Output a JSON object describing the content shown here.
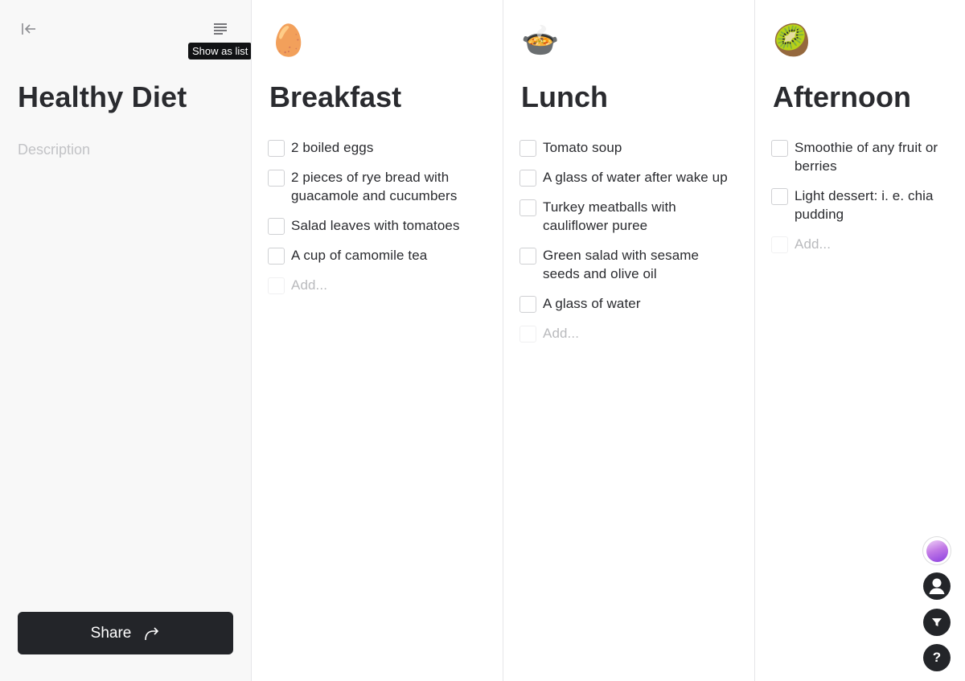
{
  "sidebar": {
    "title": "Healthy Diet",
    "description_placeholder": "Description",
    "tooltip": "Show as list",
    "share_label": "Share",
    "icons": {
      "collapse": "collapse-left-icon",
      "list": "list-view-icon",
      "share": "share-arrow-icon"
    }
  },
  "columns": [
    {
      "emoji": "🥚",
      "title": "Breakfast",
      "items": [
        "2 boiled eggs",
        "2 pieces of rye bread with guacamole and cucumbers",
        "Salad leaves with tomatoes",
        "A cup of camomile tea"
      ],
      "add_placeholder": "Add..."
    },
    {
      "emoji": "🍲",
      "title": "Lunch",
      "items": [
        "Tomato soup",
        "A glass of water after wake up",
        "Turkey meatballs with cauliflower puree",
        "Green salad with sesame seeds and olive oil",
        "A glass of water"
      ],
      "add_placeholder": "Add..."
    },
    {
      "emoji": "🥝",
      "title": "Afternoon",
      "items": [
        "Smoothie of any fruit or berries",
        "Light dessert: i. e. chia pudding"
      ],
      "add_placeholder": "Add..."
    }
  ],
  "floating": {
    "help_label": "?",
    "icons": [
      "workspace-avatar-icon",
      "profile-icon",
      "filter-icon",
      "help-icon"
    ]
  },
  "colors": {
    "accent": "#232529",
    "sidebar_bg": "#f8f8f8",
    "muted": "#c2c3c6"
  }
}
